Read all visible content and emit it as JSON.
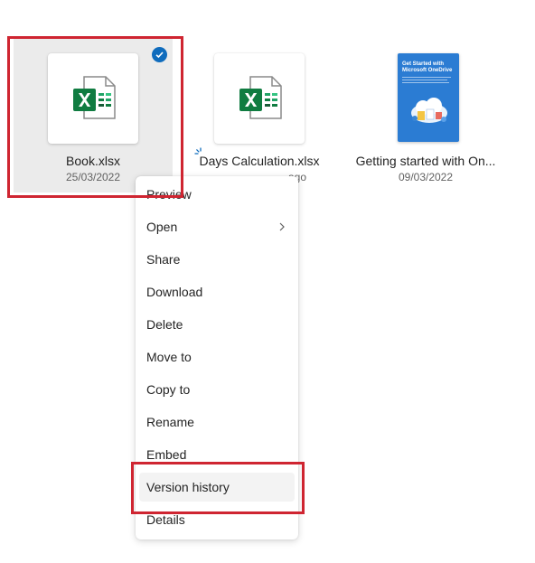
{
  "files": [
    {
      "name": "Book.xlsx",
      "date": "25/03/2022",
      "type": "excel-icon",
      "selected": true
    },
    {
      "name": "Days Calculation.xlsx",
      "date": "ago",
      "type": "excel-icon",
      "selected": false
    },
    {
      "name": "Getting started with On...",
      "date": "09/03/2022",
      "type": "document-thumbnail",
      "thumbnail_title": "Get Started with Microsoft OneDrive",
      "selected": false
    }
  ],
  "context_menu": {
    "items": [
      {
        "label": "Preview"
      },
      {
        "label": "Open",
        "has_submenu": true
      },
      {
        "label": "Share"
      },
      {
        "label": "Download"
      },
      {
        "label": "Delete"
      },
      {
        "label": "Move to"
      },
      {
        "label": "Copy to"
      },
      {
        "label": "Rename"
      },
      {
        "label": "Embed"
      },
      {
        "label": "Version history",
        "highlighted": true
      },
      {
        "label": "Details"
      }
    ]
  },
  "colors": {
    "excel_green": "#107c41",
    "selection_check": "#0f6cbd",
    "highlight_red": "#cf2531",
    "onedrive_blue": "#2b7cd3"
  }
}
